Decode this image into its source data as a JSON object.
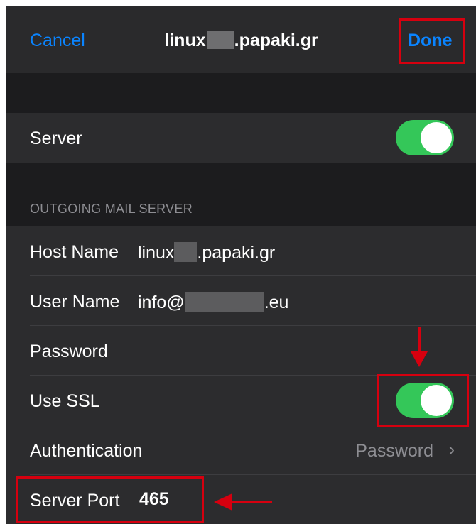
{
  "nav": {
    "cancel": "Cancel",
    "title_prefix": "linux",
    "title_suffix": ".papaki.gr",
    "done": "Done"
  },
  "server_row": {
    "label": "Server",
    "toggle_on": true
  },
  "section": {
    "header": "OUTGOING MAIL SERVER"
  },
  "fields": {
    "host_label": "Host Name",
    "host_prefix": "linux",
    "host_suffix": ".papaki.gr",
    "user_label": "User Name",
    "user_prefix": "info@",
    "user_suffix": ".eu",
    "password_label": "Password",
    "ssl_label": "Use SSL",
    "ssl_on": true,
    "auth_label": "Authentication",
    "auth_value": "Password",
    "port_label": "Server Port",
    "port_value": "465"
  },
  "colors": {
    "accent": "#0a84ff",
    "toggle_on": "#34c759",
    "highlight": "#d6000f",
    "background": "#1c1c1e"
  },
  "icons": [
    "chevron-right-icon",
    "down-arrow-annotation",
    "left-arrow-annotation"
  ]
}
